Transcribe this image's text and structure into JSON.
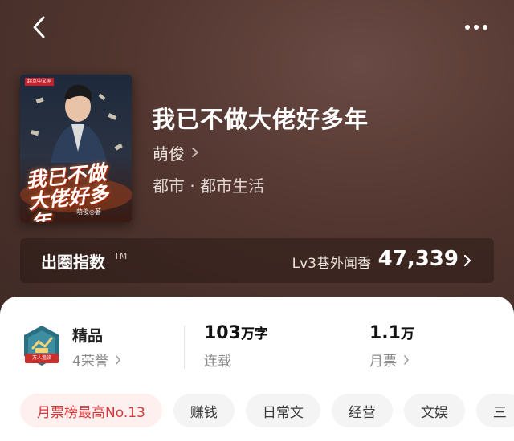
{
  "header": {
    "back_icon": "chevron-left-icon",
    "more_icon": "more-horizontal-icon"
  },
  "book": {
    "title": "我已不做大佬好多年",
    "author": "萌俊",
    "genre": "都市 · 都市生活",
    "cover": {
      "brand": "起点中文网",
      "title": "我已不做\n大佬好多年",
      "author": "萌俊◎著"
    }
  },
  "index": {
    "label": "出圈指数",
    "tm": "TM",
    "level": "Lv3巷外闻香",
    "value": "47,339"
  },
  "stats": {
    "badge_ribbon": "万人追读",
    "quality": {
      "title": "精品",
      "sub": "4荣誉"
    },
    "words": {
      "number": "103",
      "unit": "万字",
      "sub": "连载"
    },
    "tickets": {
      "number": "1.1",
      "unit": "万",
      "sub": "月票"
    }
  },
  "tags": [
    "月票榜最高No.13",
    "赚钱",
    "日常文",
    "经营",
    "文娱",
    "三"
  ],
  "colors": {
    "hero_bg": "#52362f",
    "accent_red": "#d6363a",
    "badge_teal": "#2a6f82"
  }
}
